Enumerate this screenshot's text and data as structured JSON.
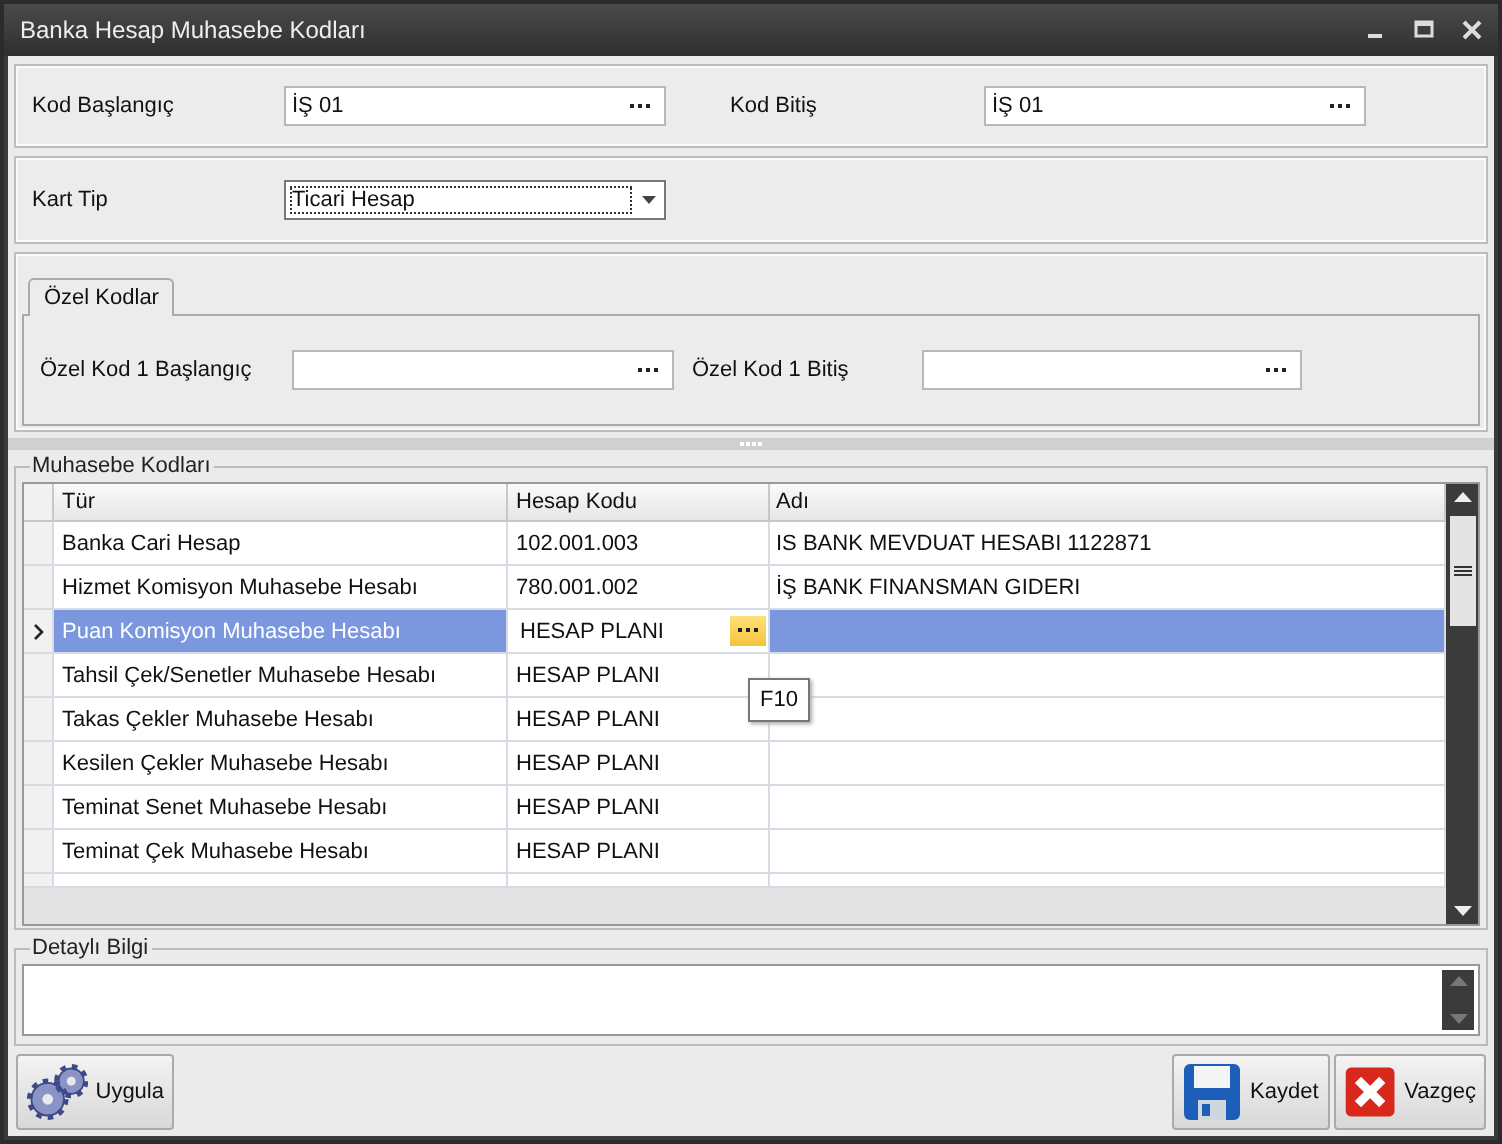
{
  "window": {
    "title": "Banka Hesap Muhasebe Kodları"
  },
  "range_fields": [
    {
      "label": "Kod Başlangıç",
      "value": "İŞ 01"
    },
    {
      "label": "Kod Bitiş",
      "value": "İŞ 01"
    }
  ],
  "card_type": {
    "label": "Kart Tip",
    "value": "Ticari Hesap"
  },
  "tabs": [
    {
      "label": "Özel Kodlar",
      "selected": true
    }
  ],
  "special_fields": [
    {
      "label": "Özel Kod 1 Başlangıç"
    },
    {
      "label": "Özel Kod 1 Bitiş"
    }
  ],
  "accounting_codes": {
    "title": "Muhasebe Kodları",
    "columns": [
      "Tür",
      "Hesap Kodu",
      "Adı"
    ],
    "tooltip": "F10",
    "rows": [
      {
        "type": "Banka Cari Hesap",
        "code": "102.001.003",
        "name": "IS BANK MEVDUAT HESABI 1122871",
        "selected": false
      },
      {
        "type": "Hizmet Komisyon Muhasebe Hesabı",
        "code": "780.001.002",
        "name": "İŞ BANK FINANSMAN GIDERI",
        "selected": false
      },
      {
        "type": "Puan Komisyon Muhasebe Hesabı",
        "code": "HESAP PLANI",
        "selected": true
      },
      {
        "type": "Tahsil Çek/Senetler Muhasebe Hesabı",
        "code": "HESAP PLANI",
        "selected": false
      },
      {
        "type": "Takas Çekler Muhasebe Hesabı",
        "code": "HESAP PLANI",
        "selected": false
      },
      {
        "type": "Kesilen Çekler Muhasebe Hesabı",
        "code": "HESAP PLANI",
        "selected": false
      },
      {
        "type": "Teminat Senet Muhasebe Hesabı",
        "code": "HESAP PLANI",
        "selected": false
      },
      {
        "type": "Teminat Çek Muhasebe Hesabı",
        "code": "HESAP PLANI",
        "selected": false
      }
    ]
  },
  "details": {
    "title": "Detaylı Bilgi"
  },
  "buttons": [
    {
      "label": "Uygula",
      "kind": "apply"
    },
    {
      "label": "Kaydet",
      "kind": "save"
    },
    {
      "label": "Vazgeç",
      "kind": "cancel"
    }
  ]
}
